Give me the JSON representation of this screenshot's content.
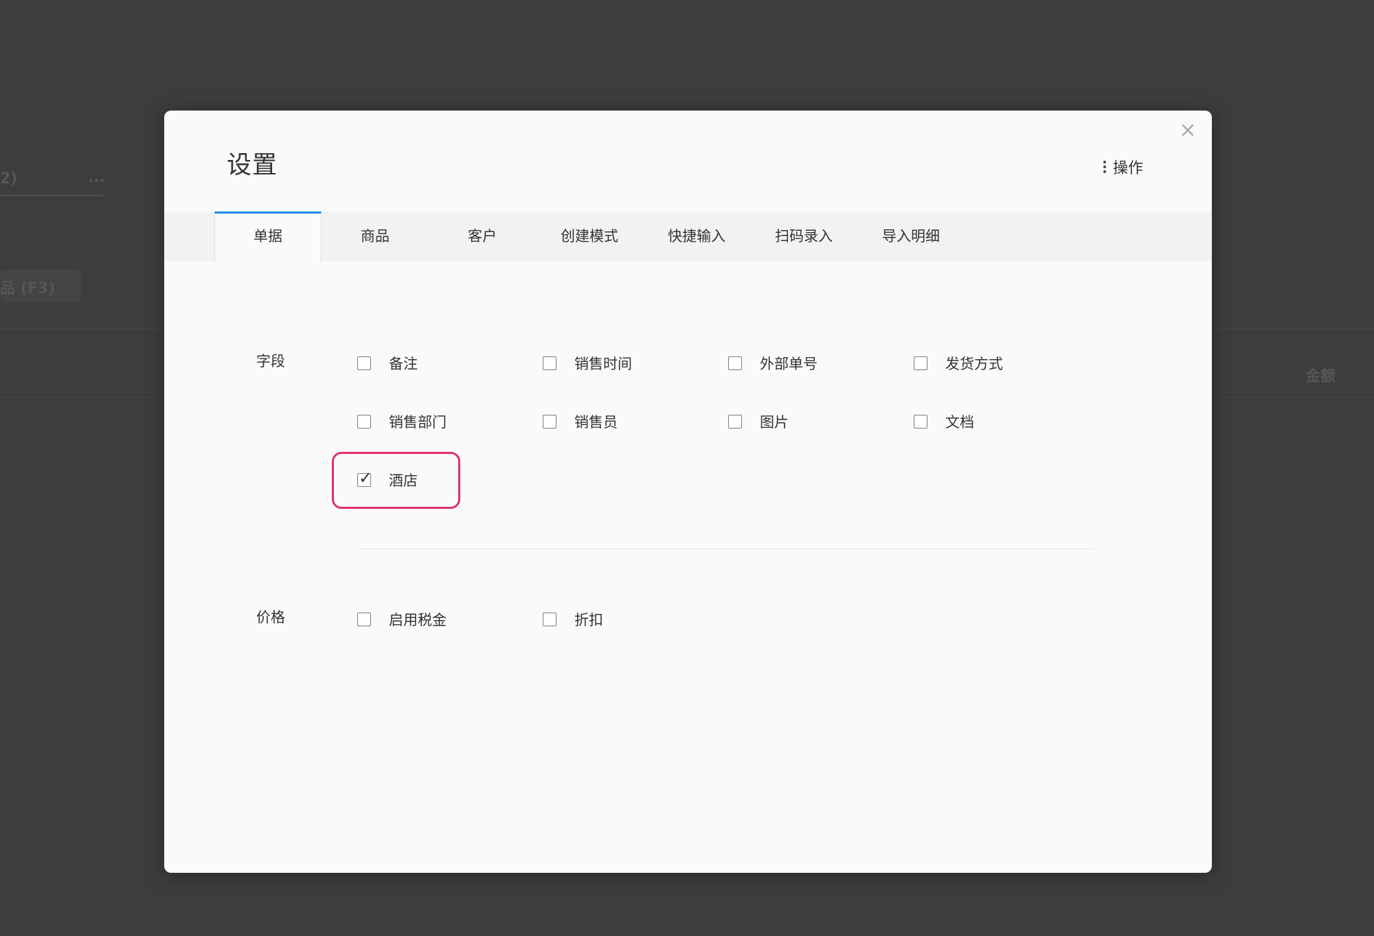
{
  "dialog": {
    "title": "设置",
    "actions_label": "操作",
    "close_symbol": "×"
  },
  "tabs": [
    {
      "label": "单据",
      "active": true
    },
    {
      "label": "商品",
      "active": false
    },
    {
      "label": "客户",
      "active": false
    },
    {
      "label": "创建模式",
      "active": false
    },
    {
      "label": "快捷输入",
      "active": false
    },
    {
      "label": "扫码录入",
      "active": false
    },
    {
      "label": "导入明细",
      "active": false
    }
  ],
  "fields_section": {
    "label": "字段",
    "options": [
      {
        "label": "备注",
        "checked": false
      },
      {
        "label": "销售时间",
        "checked": false
      },
      {
        "label": "外部单号",
        "checked": false
      },
      {
        "label": "发货方式",
        "checked": false
      },
      {
        "label": "销售部门",
        "checked": false
      },
      {
        "label": "销售员",
        "checked": false
      },
      {
        "label": "图片",
        "checked": false
      },
      {
        "label": "文档",
        "checked": false
      },
      {
        "label": "酒店",
        "checked": true
      }
    ]
  },
  "price_section": {
    "label": "价格",
    "options": [
      {
        "label": "启用税金",
        "checked": false
      },
      {
        "label": "折扣",
        "checked": false
      }
    ]
  },
  "colors": {
    "backdrop": "#3d3d3d",
    "active_tab_accent": "#1e88e5",
    "highlight": "#e0306a"
  },
  "background_page": {
    "fragments": [
      "2)",
      "...",
      "品 (F3)",
      "金额"
    ]
  }
}
